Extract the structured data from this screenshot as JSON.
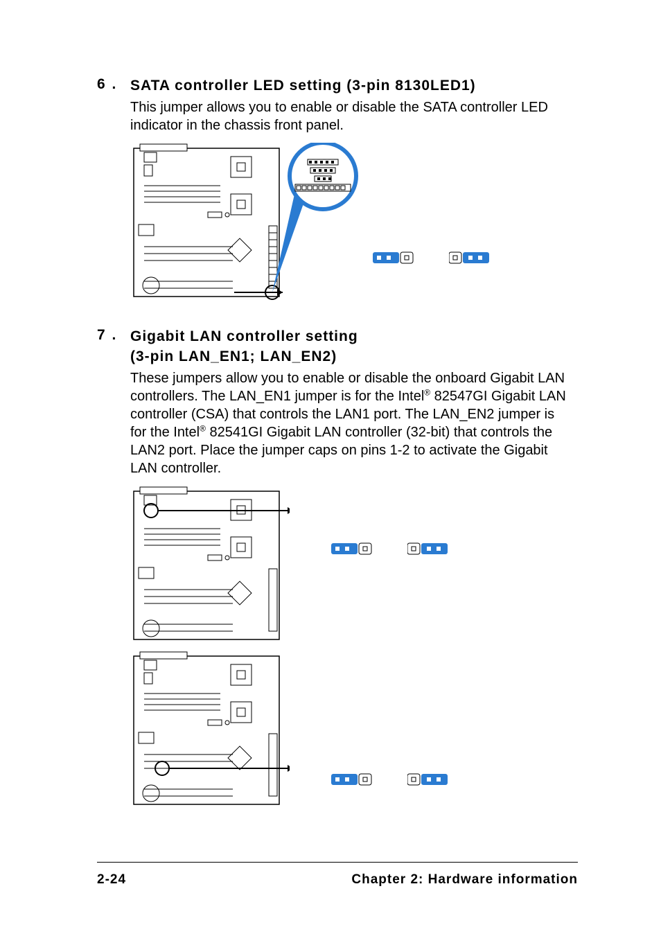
{
  "section6": {
    "num": "6 .",
    "title": "SATA controller LED setting (3-pin 8130LED1)",
    "body": "This jumper allows you to enable or disable the SATA controller LED indicator in the chassis front panel."
  },
  "section7": {
    "num": "7 .",
    "title_l1": "Gigabit LAN controller setting",
    "title_l2": "(3-pin LAN_EN1; LAN_EN2)",
    "body_pre": "These jumpers allow you to enable or disable the onboard Gigabit LAN controllers. The LAN_EN1 jumper is for the  Intel",
    "body_mid": " 82547GI Gigabit LAN controller (CSA) that controls the LAN1 port. The LAN_EN2 jumper is for the Intel",
    "body_post": " 82541GI Gigabit LAN controller (32-bit) that controls the LAN2 port. Place the jumper caps on pins 1-2 to activate the Gigabit LAN controller."
  },
  "footer": {
    "page": "2-24",
    "chapter": "Chapter 2: Hardware information"
  },
  "colors": {
    "accent": "#2a7bd1",
    "accent_dark": "#1f5fa6"
  }
}
